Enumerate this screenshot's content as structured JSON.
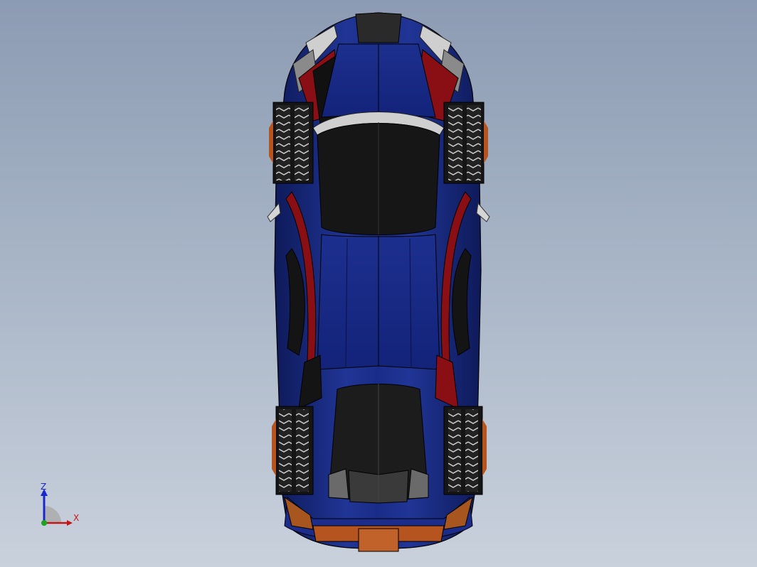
{
  "viewport": {
    "background_top": "#8c9bb3",
    "background_bottom": "#c9d1dc"
  },
  "model": {
    "description_icon": "car-top-view",
    "colors": {
      "body_blue": "#1c2f8f",
      "body_blue_dark": "#12206a",
      "accent_red": "#8a0f14",
      "glass_black": "#141414",
      "tire_dark": "#1e1e1e",
      "tire_light": "#d8d8d8",
      "trim_orange": "#b5541e",
      "trim_gray": "#9a9a9a"
    }
  },
  "triad": {
    "z_label": "Z",
    "x_label": "X",
    "z_color": "#1a27c9",
    "x_color": "#c41616",
    "y_color": "#1ea31e"
  }
}
